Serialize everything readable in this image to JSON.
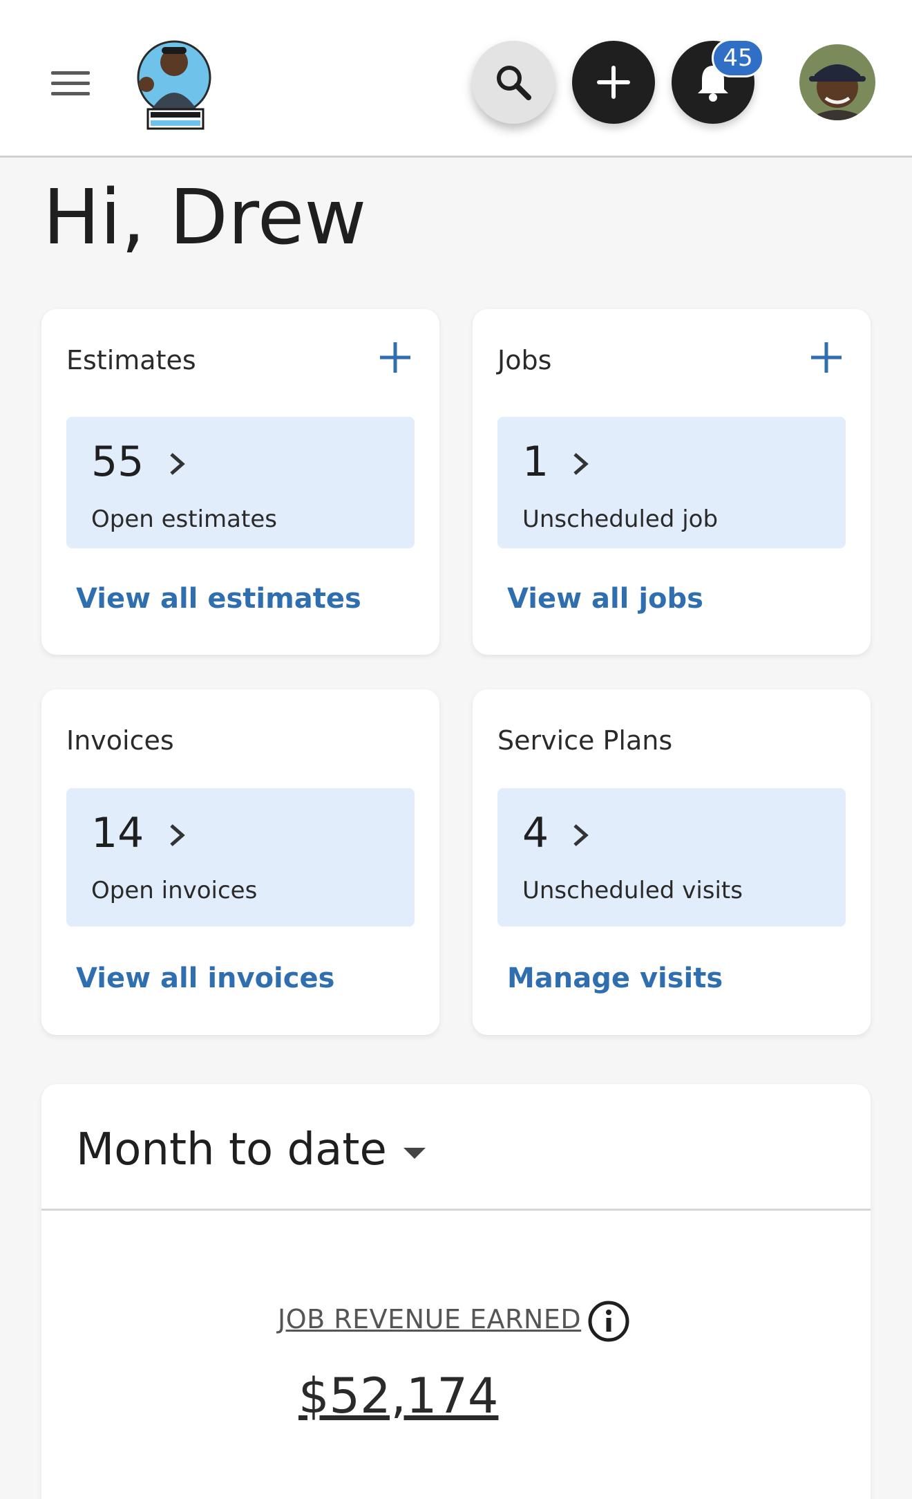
{
  "header": {
    "notifications_count": "45",
    "icons": [
      "menu-icon",
      "search-icon",
      "plus-icon",
      "bell-icon"
    ]
  },
  "greeting": "Hi, Drew",
  "cards": {
    "estimates": {
      "title": "Estimates",
      "count": "55",
      "label": "Open estimates",
      "link": "View all estimates"
    },
    "jobs": {
      "title": "Jobs",
      "count": "1",
      "label": "Unscheduled job",
      "link": "View all jobs"
    },
    "invoices": {
      "title": "Invoices",
      "count": "14",
      "label": "Open invoices",
      "link": "View all invoices"
    },
    "service_plans": {
      "title": "Service Plans",
      "count": "4",
      "label": "Unscheduled visits",
      "link": "Manage visits"
    }
  },
  "summary": {
    "period": "Month to date",
    "metric_label": "JOB REVENUE EARNED",
    "metric_value": "$52,174"
  },
  "colors": {
    "accent": "#2f6fb0",
    "badge": "#2f6fc6",
    "stat_bg": "#e1edfb"
  }
}
